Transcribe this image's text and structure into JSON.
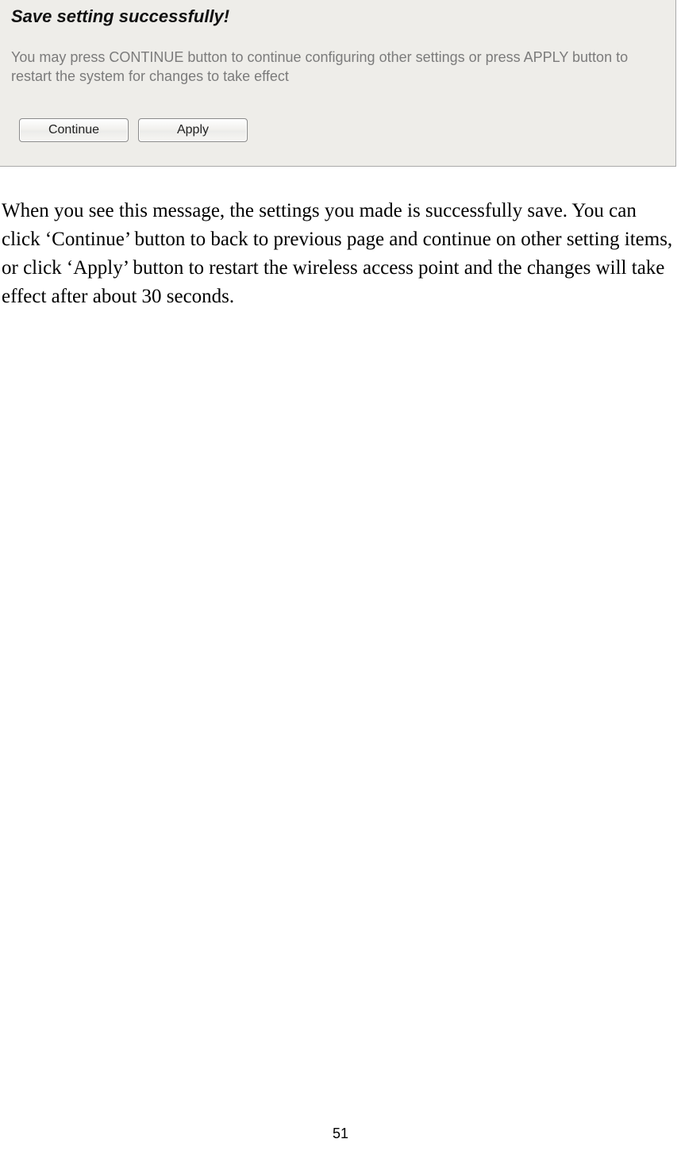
{
  "dialog": {
    "title": "Save setting successfully!",
    "note": "You may press CONTINUE button to continue configuring other settings or press APPLY button to restart the system for changes to take effect",
    "buttons": {
      "continue": "Continue",
      "apply": "Apply"
    }
  },
  "body": {
    "paragraph": "When you see this message, the settings you made is successfully save. You can click ‘Continue’ button to back to previous page and continue on other setting items, or click ‘Apply’ button to restart the wireless access point and the changes will take effect after about 30 seconds."
  },
  "page_number": "51"
}
